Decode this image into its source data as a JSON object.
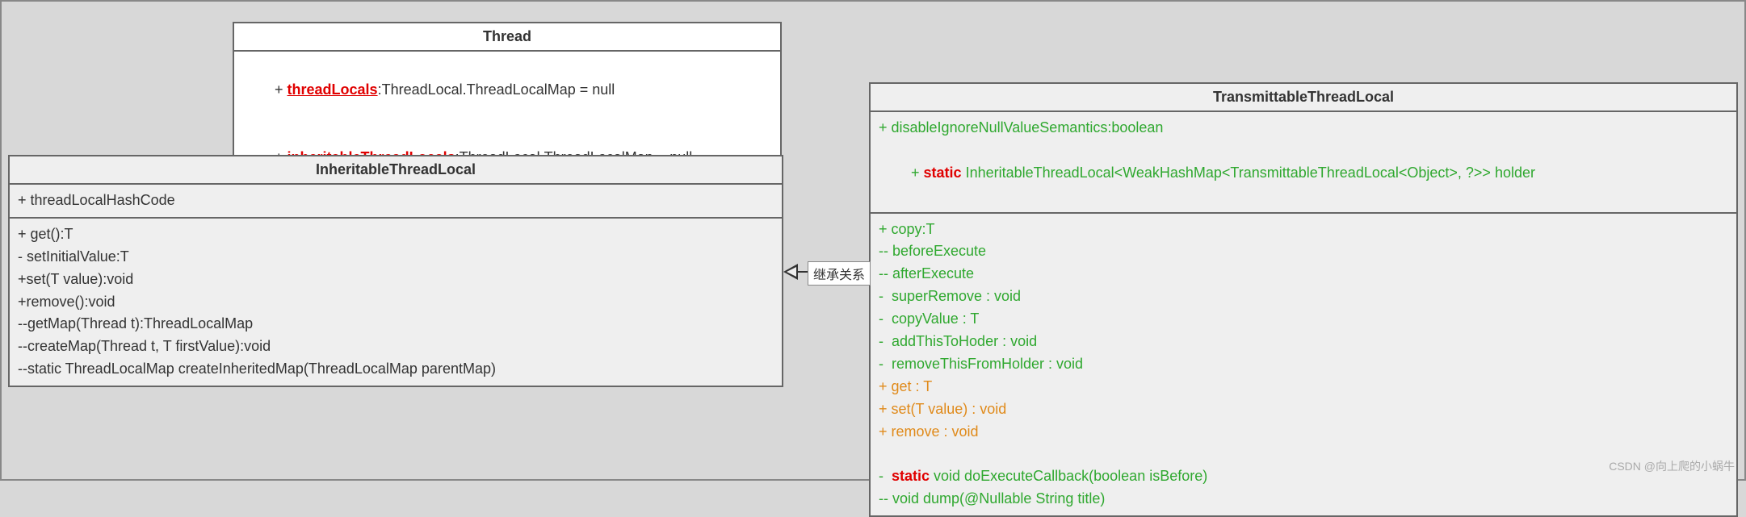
{
  "thread": {
    "title": "Thread",
    "attrs": [
      {
        "prefix": "+ ",
        "redName": "threadLocals",
        "rest": ":ThreadLocal.ThreadLocalMap = null"
      },
      {
        "prefix": "+ ",
        "redName": "inheritableThreadLocals",
        "rest": ":ThreadLocal.ThreadLocalMap = null"
      }
    ],
    "ops": "......"
  },
  "inheritable": {
    "title": "InheritableThreadLocal",
    "attrs": [
      "+ threadLocalHashCode"
    ],
    "ops": [
      "+ get():T",
      "- setInitialValue:T",
      "+set(T value):void",
      "+remove():void",
      "--getMap(Thread t):ThreadLocalMap",
      "--createMap(Thread t, T firstValue):void",
      "--static ThreadLocalMap createInheritedMap(ThreadLocalMap parentMap)"
    ]
  },
  "ttl": {
    "title": "TransmittableThreadLocal",
    "attrs": [
      {
        "cls": "green",
        "text": "+ disableIgnoreNullValueSemantics:boolean"
      },
      {
        "cls": "green",
        "prefix": "+ ",
        "red": "static",
        "rest": " InheritableThreadLocal<WeakHashMap<TransmittableThreadLocal<Object>, ?>> holder"
      }
    ],
    "ops": [
      {
        "cls": "green",
        "text": "+ copy:T"
      },
      {
        "cls": "green",
        "text": "-- beforeExecute"
      },
      {
        "cls": "green",
        "text": "-- afterExecute"
      },
      {
        "cls": "green",
        "text": "-  superRemove : void"
      },
      {
        "cls": "green",
        "text": "-  copyValue : T"
      },
      {
        "cls": "green",
        "text": "-  addThisToHoder : void"
      },
      {
        "cls": "green",
        "text": "-  removeThisFromHolder : void"
      },
      {
        "cls": "orange",
        "text": "+ get : T"
      },
      {
        "cls": "orange",
        "text": "+ set(T value) : void"
      },
      {
        "cls": "orange",
        "text": "+ remove : void"
      },
      {
        "cls": "",
        "text": " "
      },
      {
        "cls": "green",
        "prefix": "-  ",
        "red": "static",
        "rest": " void doExecuteCallback(boolean isBefore)"
      },
      {
        "cls": "green",
        "text": "-- void dump(@Nullable String title)"
      }
    ]
  },
  "relation_label": "继承关系",
  "watermark": "CSDN @向上爬的小蜗牛"
}
